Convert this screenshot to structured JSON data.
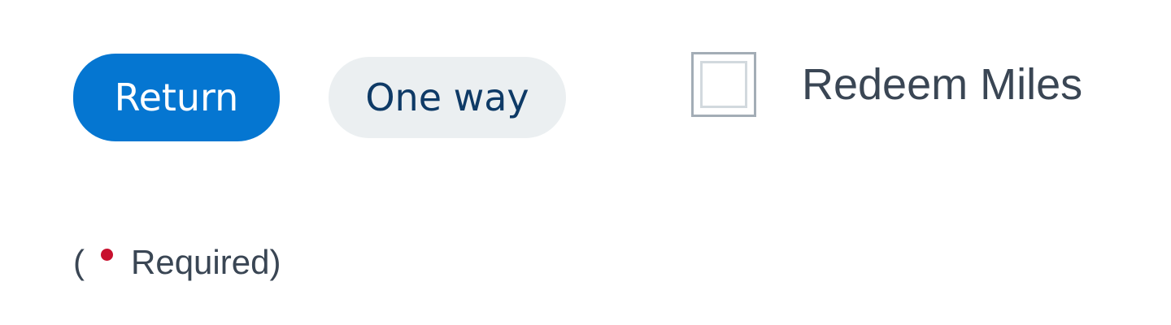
{
  "trip_type": {
    "options": [
      {
        "label": "Return",
        "selected": true
      },
      {
        "label": "One way",
        "selected": false
      }
    ]
  },
  "redeem_miles": {
    "label": "Redeem Miles",
    "checked": false
  },
  "required_note": {
    "open_paren": "(",
    "text": "Required)"
  },
  "colors": {
    "accent": "#0576d1",
    "inactive_pill": "#ebeff1",
    "required_dot": "#c8102e",
    "text": "#3a4654"
  }
}
